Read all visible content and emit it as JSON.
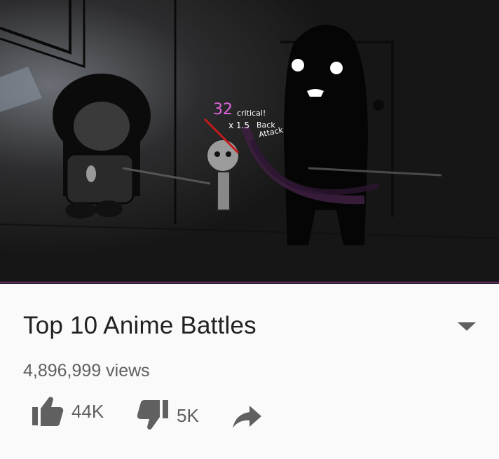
{
  "video": {
    "overlay_damage": "32",
    "overlay_critical": "critical!",
    "overlay_multiplier": "x 1.5",
    "overlay_back": "Back",
    "overlay_attack": "Attack"
  },
  "info": {
    "title": "Top 10 Anime Battles",
    "views": "4,896,999 views"
  },
  "actions": {
    "like_count": "44K",
    "dislike_count": "5K"
  },
  "icons": {
    "expand": "chevron-down-icon",
    "like": "thumbs-up-icon",
    "dislike": "thumbs-down-icon",
    "share": "share-arrow-icon"
  },
  "colors": {
    "icon_gray": "#606060",
    "title_text": "#212121",
    "damage_pink": "#e066e0"
  }
}
